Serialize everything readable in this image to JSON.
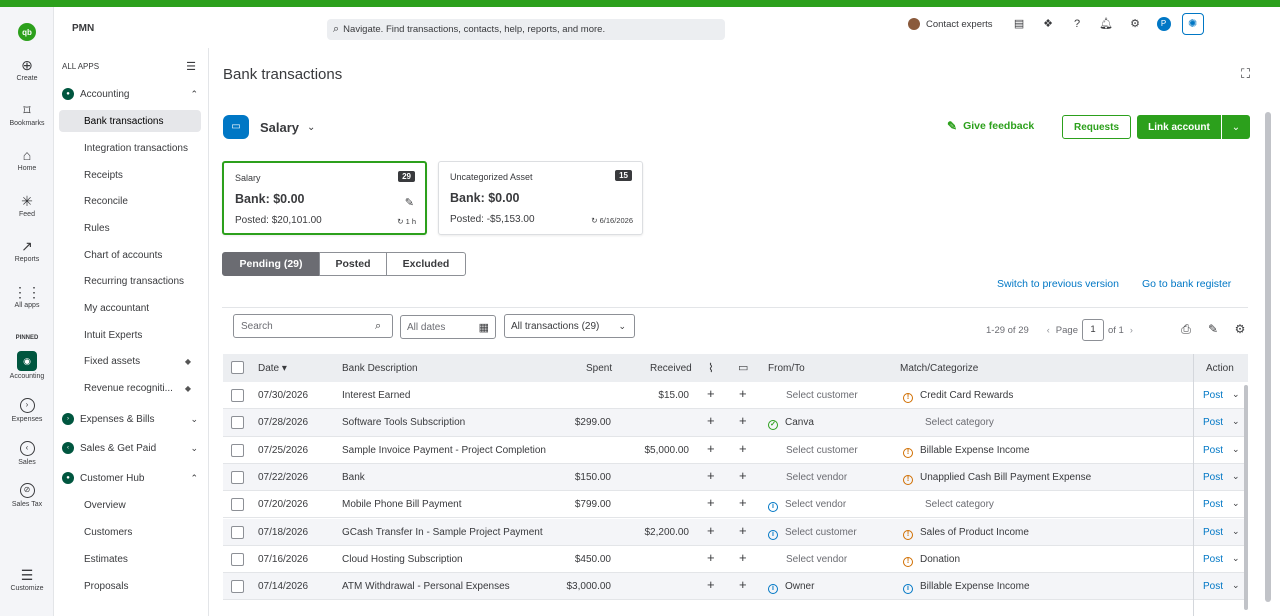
{
  "app": {
    "company": "PMN",
    "logo": "qb"
  },
  "search": {
    "placeholder": "Navigate. Find transactions, contacts, help, reports, and more."
  },
  "header": {
    "contact_label": "Contact experts",
    "user_initial": "P"
  },
  "rail": {
    "items": [
      {
        "label": "Create",
        "icon": "plus-circle-icon"
      },
      {
        "label": "Bookmarks",
        "icon": "bookmark-icon"
      },
      {
        "label": "Home",
        "icon": "home-icon"
      },
      {
        "label": "Feed",
        "icon": "feed-icon"
      },
      {
        "label": "Reports",
        "icon": "reports-icon"
      },
      {
        "label": "All apps",
        "icon": "grid-icon"
      }
    ],
    "pinned_label": "PINNED",
    "pinned": [
      {
        "label": "Accounting",
        "icon": "accounting-icon"
      },
      {
        "label": "Expenses",
        "icon": "expenses-icon"
      },
      {
        "label": "Sales",
        "icon": "sales-icon"
      },
      {
        "label": "Sales Tax",
        "icon": "sales-tax-icon"
      }
    ],
    "customize_label": "Customize"
  },
  "sidebar": {
    "header": "ALL APPS",
    "accounting": "Accounting",
    "accounting_items": [
      "Bank transactions",
      "Integration transactions",
      "Receipts",
      "Reconcile",
      "Rules",
      "Chart of accounts",
      "Recurring transactions",
      "My accountant",
      "Intuit Experts",
      "Fixed assets",
      "Revenue recogniti..."
    ],
    "expenses": "Expenses & Bills",
    "sales": "Sales & Get Paid",
    "customer_hub": "Customer Hub",
    "customer_items": [
      "Overview",
      "Customers",
      "Estimates",
      "Proposals"
    ]
  },
  "page": {
    "title": "Bank transactions",
    "account": "Salary",
    "give_feedback": "Give feedback",
    "requests": "Requests",
    "link_account": "Link account",
    "switch_version": "Switch to previous version",
    "bank_register": "Go to bank register"
  },
  "cards": [
    {
      "name": "Salary",
      "count": "29",
      "bank": "Bank: $0.00",
      "posted": "Posted: $20,101.00",
      "sync": "1 h"
    },
    {
      "name": "Uncategorized Asset",
      "count": "15",
      "bank": "Bank: $0.00",
      "posted": "Posted: -$5,153.00",
      "sync": "6/16/2026"
    }
  ],
  "tabs": [
    "Pending (29)",
    "Posted",
    "Excluded"
  ],
  "filters": {
    "search_placeholder": "Search",
    "dates": "All dates",
    "transactions": "All transactions (29)",
    "range": "1-29 of 29",
    "page_label": "Page",
    "page": "1",
    "of": "of 1"
  },
  "columns": [
    "Date",
    "Bank Description",
    "Spent",
    "Received",
    "From/To",
    "Match/Categorize",
    "Action"
  ],
  "rows": [
    {
      "date": "07/30/2026",
      "desc": "Interest Earned",
      "spent": "",
      "received": "$15.00",
      "fromto": "Select customer",
      "from_icon": "",
      "match": "Credit Card Rewards",
      "match_icon": "warn",
      "action": "Post"
    },
    {
      "date": "07/28/2026",
      "desc": "Software Tools Subscription",
      "spent": "$299.00",
      "received": "",
      "fromto": "Canva",
      "from_icon": "ok",
      "match": "Select category",
      "match_icon": "",
      "action": "Post"
    },
    {
      "date": "07/25/2026",
      "desc": "Sample Invoice Payment - Project Completion",
      "spent": "",
      "received": "$5,000.00",
      "fromto": "Select customer",
      "from_icon": "",
      "match": "Billable Expense Income",
      "match_icon": "warn",
      "action": "Post"
    },
    {
      "date": "07/22/2026",
      "desc": "Bank",
      "spent": "$150.00",
      "received": "",
      "fromto": "Select vendor",
      "from_icon": "",
      "match": "Unapplied Cash Bill Payment Expense",
      "match_icon": "warn",
      "action": "Post"
    },
    {
      "date": "07/20/2026",
      "desc": "Mobile Phone Bill Payment",
      "spent": "$799.00",
      "received": "",
      "fromto": "Select vendor",
      "from_icon": "info",
      "match": "Select category",
      "match_icon": "",
      "action": "Post"
    },
    {
      "date": "07/18/2026",
      "desc": "GCash Transfer In - Sample Project Payment",
      "spent": "",
      "received": "$2,200.00",
      "fromto": "Select customer",
      "from_icon": "info",
      "match": "Sales of Product Income",
      "match_icon": "warn",
      "action": "Post"
    },
    {
      "date": "07/16/2026",
      "desc": "Cloud Hosting Subscription",
      "spent": "$450.00",
      "received": "",
      "fromto": "Select vendor",
      "from_icon": "",
      "match": "Donation",
      "match_icon": "warn",
      "action": "Post"
    },
    {
      "date": "07/14/2026",
      "desc": "ATM Withdrawal - Personal Expenses",
      "spent": "$3,000.00",
      "received": "",
      "fromto": "Owner",
      "from_icon": "info",
      "match": "Billable Expense Income",
      "match_icon": "info",
      "action": "Post"
    }
  ],
  "colors": {
    "brand_green": "#2ca01c",
    "link_blue": "#0077c5",
    "warn_orange": "#d06e00"
  }
}
